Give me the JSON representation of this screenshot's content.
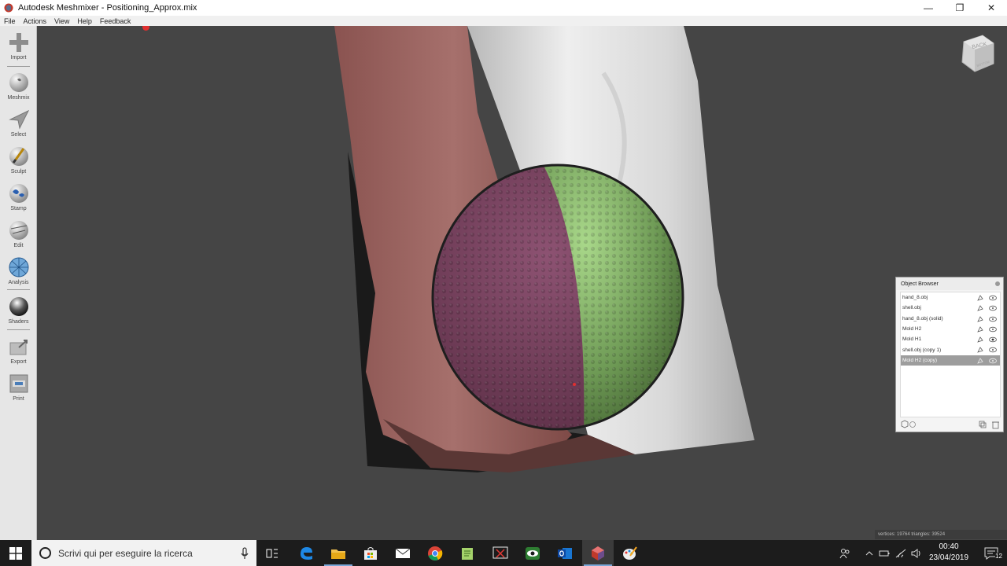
{
  "window": {
    "title": "Autodesk Meshmixer - Positioning_Approx.mix",
    "minimize": "—",
    "restore": "❐",
    "close": "✕"
  },
  "menu": [
    "File",
    "Actions",
    "View",
    "Help",
    "Feedback"
  ],
  "toolbar": {
    "import": "Import",
    "meshmix": "Meshmix",
    "select": "Select",
    "sculpt": "Sculpt",
    "stamp": "Stamp",
    "edit": "Edit",
    "analysis": "Analysis",
    "shaders": "Shaders",
    "export": "Export",
    "print": "Print"
  },
  "viewcube": {
    "label": "BACK",
    "sub": "BOTTOM"
  },
  "object_browser": {
    "title": "Object Browser",
    "items": [
      {
        "name": "hand_8.obj",
        "visible": true,
        "selected": false
      },
      {
        "name": "shell.obj",
        "visible": true,
        "selected": false
      },
      {
        "name": "hand_8.obj (solid)",
        "visible": true,
        "selected": false
      },
      {
        "name": "Mold H2",
        "visible": true,
        "selected": false
      },
      {
        "name": "Mold H1",
        "visible": true,
        "selected": false
      },
      {
        "name": "shell.obj (copy 1)",
        "visible": true,
        "selected": false
      },
      {
        "name": "Mold H2 (copy)",
        "visible": true,
        "selected": true
      }
    ]
  },
  "stats": "vertices: 19764 triangles: 39524",
  "taskbar": {
    "search_placeholder": "Scrivi qui per eseguire la ricerca",
    "time": "00:40",
    "date": "23/04/2019",
    "notifications": "12"
  },
  "colors": {
    "viewport_bg": "#454545",
    "hand": "#9a5f5c",
    "shell": "#e0e0e0",
    "sphere_left": "#7a4460",
    "sphere_right": "#6e9a55",
    "selected_row": "#9d9d9d"
  }
}
